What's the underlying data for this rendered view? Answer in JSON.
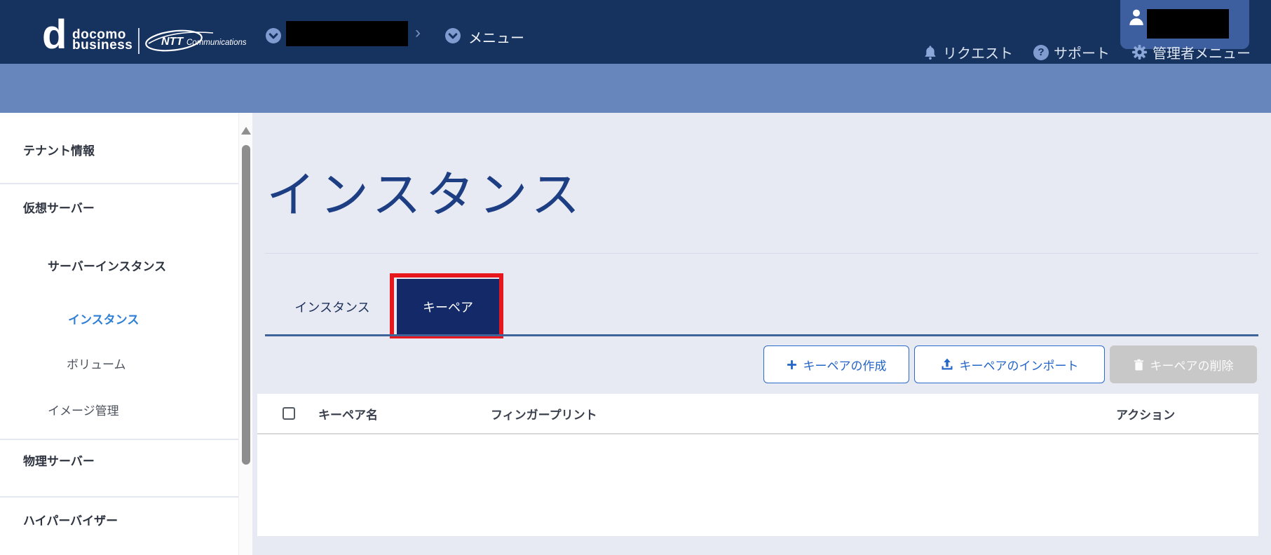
{
  "topbar": {
    "docomo_logo": {
      "d": "d",
      "line1": "docomo",
      "line2": "business"
    },
    "ntt_logo": {
      "bold": "NTT",
      "rest": "Communications"
    },
    "breadcrumb_chevron": "›",
    "menu_label": "メニュー",
    "help_glyph": "?",
    "nav_items": [
      {
        "label": "リクエスト",
        "icon": "bell-icon"
      },
      {
        "label": "サポート",
        "icon": "help-icon"
      },
      {
        "label": "管理者メニュー",
        "icon": "gear-icon"
      }
    ],
    "redacted_regions": [
      "tenant-selector",
      "user-name"
    ]
  },
  "subbar": {
    "redacted_regions": [
      "workspace-selector"
    ]
  },
  "sidebar": {
    "items": [
      {
        "label": "テナント情報",
        "level": 1,
        "active": false
      },
      {
        "label": "仮想サーバー",
        "level": 1,
        "active": false
      },
      {
        "label": "サーバーインスタンス",
        "level": 2,
        "active": false
      },
      {
        "label": "インスタンス",
        "level": 3,
        "active": true
      },
      {
        "label": "ボリューム",
        "level": 3,
        "active": false
      },
      {
        "label": "イメージ管理",
        "level": 2,
        "active": false
      },
      {
        "label": "物理サーバー",
        "level": 1,
        "active": false
      },
      {
        "label": "ハイパーバイザー",
        "level": 1,
        "active": false
      }
    ]
  },
  "main": {
    "title": "インスタンス",
    "tabs": [
      {
        "label": "インスタンス",
        "active": false
      },
      {
        "label": "キーペア",
        "active": true
      }
    ],
    "annotation": {
      "type": "red-box",
      "target": "キーペア tab"
    },
    "buttons": [
      {
        "label": "キーペアの作成",
        "icon": "plus-icon",
        "enabled": true
      },
      {
        "label": "キーペアのインポート",
        "icon": "upload-icon",
        "enabled": true
      },
      {
        "label": "キーペアの削除",
        "icon": "trash-icon",
        "enabled": false
      }
    ],
    "table": {
      "headers": [
        "キーペア名",
        "フィンガープリント",
        "アクション"
      ],
      "rows": []
    }
  },
  "colors": {
    "topbar": "#16325f",
    "subbar": "#6787bc",
    "accent_blue": "#2465c8",
    "active_tab": "#142a68",
    "title": "#1d3e83",
    "annotation_red": "#e8161d",
    "sidebar_active": "#2f7fd6",
    "main_bg": "#e7eaf3"
  }
}
